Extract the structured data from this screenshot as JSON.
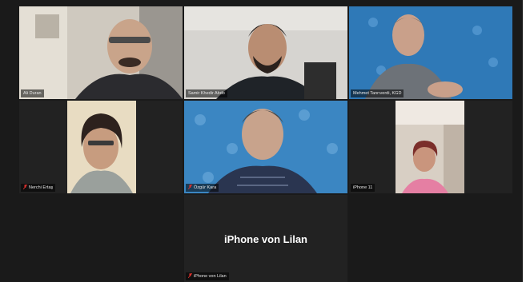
{
  "meeting": {
    "participants": [
      {
        "name": "Ali Duran",
        "muted": false,
        "active_speaker": false
      },
      {
        "name": "Samir Khedir Abdo",
        "muted": false,
        "active_speaker": true
      },
      {
        "name": "Mehmet Tanrıverdi, KGD",
        "muted": false,
        "active_speaker": false
      },
      {
        "name": "Nerchi Ertaş",
        "muted": true,
        "active_speaker": false
      },
      {
        "name": "Özgür Kara",
        "muted": true,
        "active_speaker": false
      },
      {
        "name": "iPhone 11",
        "muted": false,
        "active_speaker": false
      },
      {
        "name": "iPhone von Lilan",
        "muted": true,
        "active_speaker": false,
        "video_off_label": "iPhone von Lilan"
      }
    ]
  },
  "colors": {
    "active_outline": "#c9e35b",
    "muted_icon": "#e0312d",
    "blue_backdrop": "#2f79b7"
  }
}
